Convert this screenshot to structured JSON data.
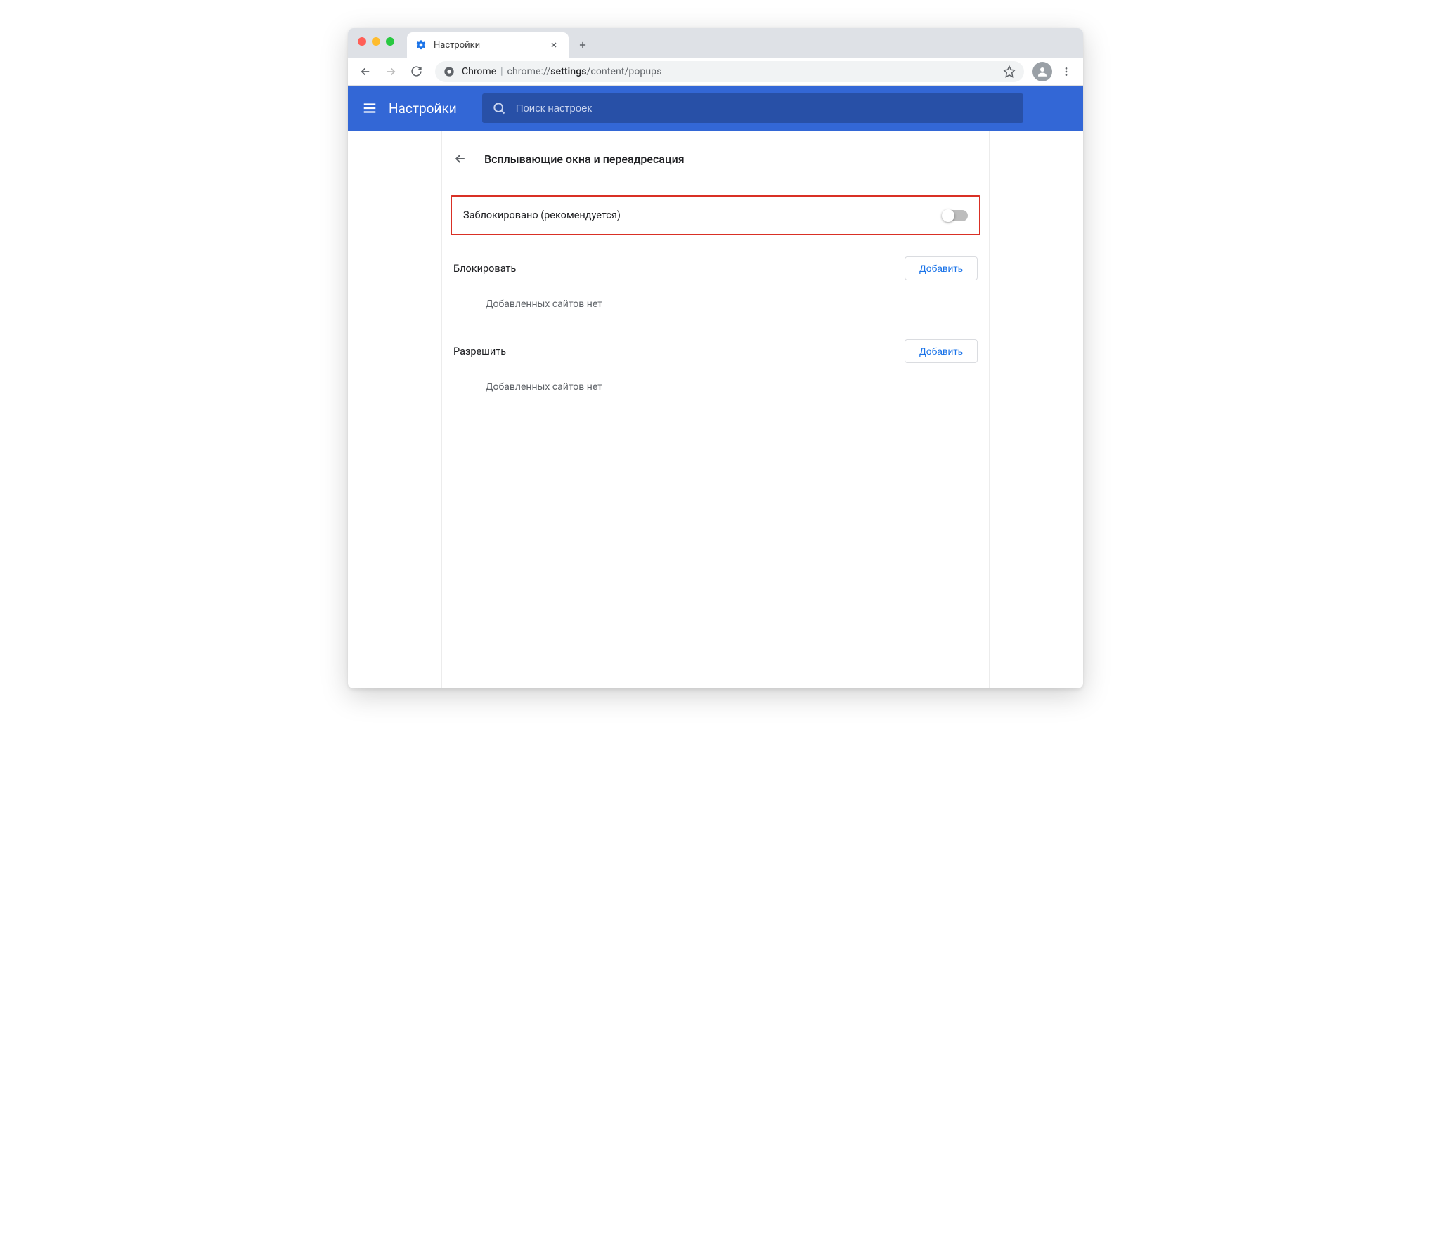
{
  "browser": {
    "tab_title": "Настройки",
    "omnibox_label": "Chrome",
    "url_prefix": "chrome://",
    "url_bold": "settings",
    "url_suffix": "/content/popups"
  },
  "header": {
    "title": "Настройки",
    "search_placeholder": "Поиск настроек"
  },
  "page": {
    "title": "Всплывающие окна и переадресация",
    "toggle_label": "Заблокировано (рекомендуется)",
    "block_section": {
      "title": "Блокировать",
      "add_label": "Добавить",
      "empty": "Добавленных сайтов нет"
    },
    "allow_section": {
      "title": "Разрешить",
      "add_label": "Добавить",
      "empty": "Добавленных сайтов нет"
    }
  }
}
